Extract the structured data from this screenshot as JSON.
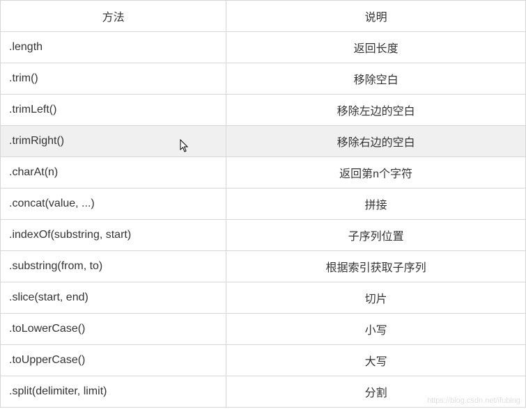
{
  "headers": {
    "method": "方法",
    "description": "说明"
  },
  "rows": [
    {
      "method": ".length",
      "description": "返回长度",
      "highlighted": false
    },
    {
      "method": ".trim()",
      "description": "移除空白",
      "highlighted": false
    },
    {
      "method": ".trimLeft()",
      "description": "移除左边的空白",
      "highlighted": false
    },
    {
      "method": ".trimRight()",
      "description": "移除右边的空白",
      "highlighted": true
    },
    {
      "method": ".charAt(n)",
      "description": "返回第n个字符",
      "highlighted": false
    },
    {
      "method": ".concat(value, ...)",
      "description": "拼接",
      "highlighted": false
    },
    {
      "method": ".indexOf(substring, start)",
      "description": "子序列位置",
      "highlighted": false
    },
    {
      "method": ".substring(from, to)",
      "description": "根据索引获取子序列",
      "highlighted": false
    },
    {
      "method": ".slice(start, end)",
      "description": "切片",
      "highlighted": false
    },
    {
      "method": ".toLowerCase()",
      "description": "小写",
      "highlighted": false
    },
    {
      "method": ".toUpperCase()",
      "description": "大写",
      "highlighted": false
    },
    {
      "method": ".split(delimiter, limit)",
      "description": "分割",
      "highlighted": false
    }
  ],
  "watermark": "https://blog.csdn.net/ifubing"
}
